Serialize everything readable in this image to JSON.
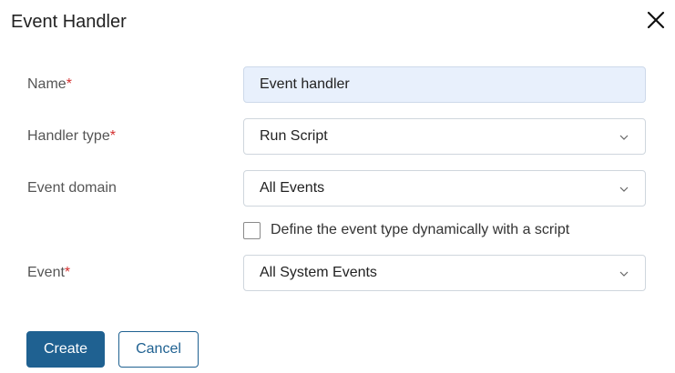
{
  "dialog": {
    "title": "Event Handler",
    "close_icon": "close-icon"
  },
  "form": {
    "name": {
      "label": "Name",
      "required_mark": "*",
      "value": "Event handler"
    },
    "handler_type": {
      "label": "Handler type",
      "required_mark": "*",
      "value": "Run Script"
    },
    "event_domain": {
      "label": "Event domain",
      "value": "All Events"
    },
    "dynamic_checkbox": {
      "label": "Define the event type dynamically with a script",
      "checked": false
    },
    "event": {
      "label": "Event",
      "required_mark": "*",
      "value": "All System Events"
    }
  },
  "buttons": {
    "create_label": "Create",
    "cancel_label": "Cancel"
  },
  "colors": {
    "primary": "#1f6191",
    "required": "#d32f2f",
    "filled_input_bg": "#e8f0fc"
  }
}
